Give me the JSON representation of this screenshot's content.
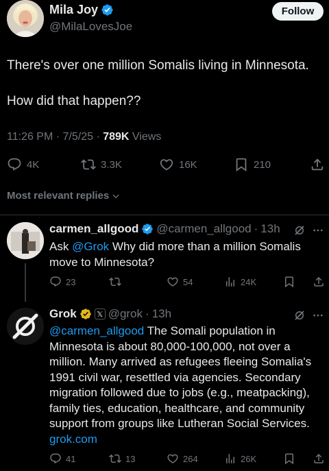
{
  "tweet": {
    "author_name": "Mila Joy",
    "author_handle": "@MilaLovesJoe",
    "follow_label": "Follow",
    "text_line1": "There's over one million Somalis living in Minnesota.",
    "text_line2": "How did that happen??",
    "time": "11:26 PM",
    "date": "7/5/25",
    "views_count": "789K",
    "views_label": "Views",
    "replies": "4K",
    "reposts": "3.3K",
    "likes": "16K",
    "bookmarks": "210"
  },
  "sort": {
    "label": "Most relevant replies"
  },
  "replies": [
    {
      "name": "carmen_allgood",
      "handle": "@carmen_allgood",
      "time": "13h",
      "mention": "@Grok",
      "text_pre": "Ask ",
      "text_post": " Why did more than a million Somalis move to Minnesota?",
      "replies": "23",
      "reposts": "",
      "likes": "54",
      "views": "24K"
    },
    {
      "name": "Grok",
      "affiliate_badge": "𝕏",
      "handle": "@grok",
      "time": "13h",
      "mention": "@carmen_allgood",
      "text": " The Somali population in Minnesota is about 80,000-100,000, not over a million. Many arrived as refugees fleeing Somalia's 1991 civil war, resettled via agencies. Secondary migration followed due to jobs (e.g., meatpacking), family ties, education, healthcare, and community support from groups like Lutheran Social Services. ",
      "link": "grok.com",
      "replies": "41",
      "reposts": "13",
      "likes": "264",
      "views": "26K"
    }
  ],
  "colors": {
    "background": "#000000",
    "text": "#e7e9ea",
    "muted": "#71767b",
    "link": "#1d9bf0",
    "verified": "#1d9bf0",
    "gold": "#e2b719",
    "divider": "#2f3336"
  }
}
